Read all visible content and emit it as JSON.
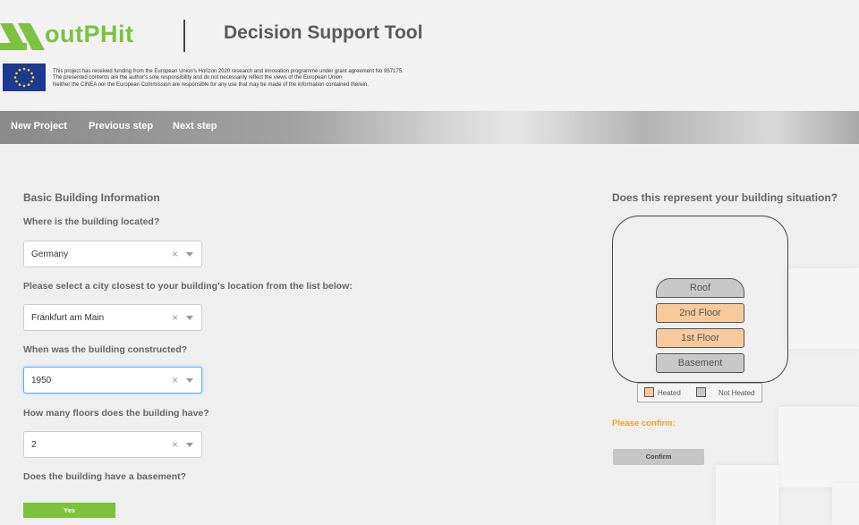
{
  "header": {
    "logo_text": "outPHit",
    "app_title": "Decision Support Tool",
    "funding_lines": [
      "This project has received funding from the European Union's Horizon 2020 research and innovation programme under grant agreement No 957175.",
      "The presented contents are the author's sole responsibility and do not necessarily reflect the views of the European Union",
      "Neither the CINEA nor the European Commission are responsible for any use that may be made of the information contained therein."
    ]
  },
  "nav": {
    "items": [
      "New Project",
      "Previous step",
      "Next step"
    ]
  },
  "form": {
    "section_title": "Basic Building Information",
    "questions": [
      {
        "label": "Where is the building located?",
        "value": "Germany"
      },
      {
        "label": "Please select a city closest to your building's location from the list below:",
        "value": "Frankfurt am Main"
      },
      {
        "label": "When was the building constructed?",
        "value": "1950"
      },
      {
        "label": "How many floors does the building have?",
        "value": "2"
      },
      {
        "label": "Does the building have a basement?"
      }
    ],
    "clear_glyph": "×",
    "yes_label": "Yes"
  },
  "diagram": {
    "title": "Does this represent your building situation?",
    "floors": [
      "Roof",
      "2nd Floor",
      "1st Floor",
      "Basement"
    ],
    "legend": {
      "heated": "Heated",
      "not_heated": "Not Heated"
    },
    "heated_color": "#f8c99a",
    "not_heated_color": "#c8c8c8",
    "confirm_prompt": "Please confirm:",
    "confirm_label": "Confirm"
  },
  "colors": {
    "brand_green": "#7cc242",
    "accent_orange": "#f0a020",
    "focus_blue": "#66afe9"
  }
}
